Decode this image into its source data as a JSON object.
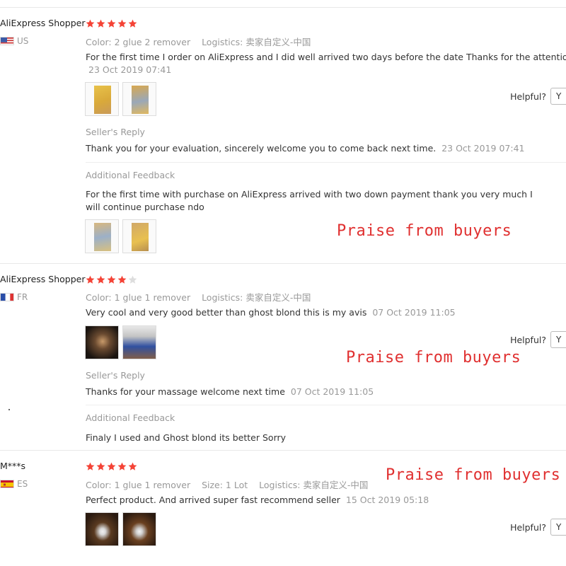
{
  "reviews": [
    {
      "user": "AliExpress Shopper",
      "country": "US",
      "stars": 5,
      "attrs": [
        {
          "key": "Color:",
          "value": "2 glue 2 remover"
        },
        {
          "key": "Logistics:",
          "value": "卖家自定义-中国"
        }
      ],
      "text": "For the first time I order on AliExpress and I did well arrived two days before the date Thanks for the attention",
      "date": "23 Oct 2019 07:41",
      "helpful_label": "Helpful?",
      "yes_label": "Y",
      "seller_reply_title": "Seller's Reply",
      "seller_reply": "Thank you for your evaluation, sincerely welcome you to come back next time.",
      "seller_reply_date": "23 Oct 2019 07:41",
      "feedback_title": "Additional Feedback",
      "feedback": "For the first time with purchase on AliExpress arrived with two down payment thank you very much I will continue purchase ndo"
    },
    {
      "user": "AliExpress Shopper",
      "country": "FR",
      "stars": 4,
      "attrs": [
        {
          "key": "Color:",
          "value": "1 glue 1 remover"
        },
        {
          "key": "Logistics:",
          "value": "卖家自定义-中国"
        }
      ],
      "text": "Very cool and very good better than ghost blond this is my avis",
      "date": "07 Oct 2019 11:05",
      "helpful_label": "Helpful?",
      "yes_label": "Y",
      "seller_reply_title": "Seller's Reply",
      "seller_reply": "Thanks for your massage welcome next time",
      "seller_reply_date": "07 Oct 2019 11:05",
      "feedback_title": "Additional Feedback",
      "feedback": "Finaly I used and Ghost blond its better Sorry"
    },
    {
      "user": "M***s",
      "country": "ES",
      "stars": 5,
      "attrs": [
        {
          "key": "Color:",
          "value": "1 glue 1 remover"
        },
        {
          "key": "Size:",
          "value": "1 Lot"
        },
        {
          "key": "Logistics:",
          "value": "卖家自定义-中国"
        }
      ],
      "text": "Perfect product. And arrived super fast recommend seller",
      "date": "15 Oct 2019 05:18",
      "helpful_label": "Helpful?",
      "yes_label": "Y"
    }
  ],
  "watermark": "Praise from buyers",
  "colors": {
    "star_active": "#f44336",
    "star_inactive": "#dddddd",
    "watermark": "#e03030",
    "muted_text": "#999999"
  }
}
